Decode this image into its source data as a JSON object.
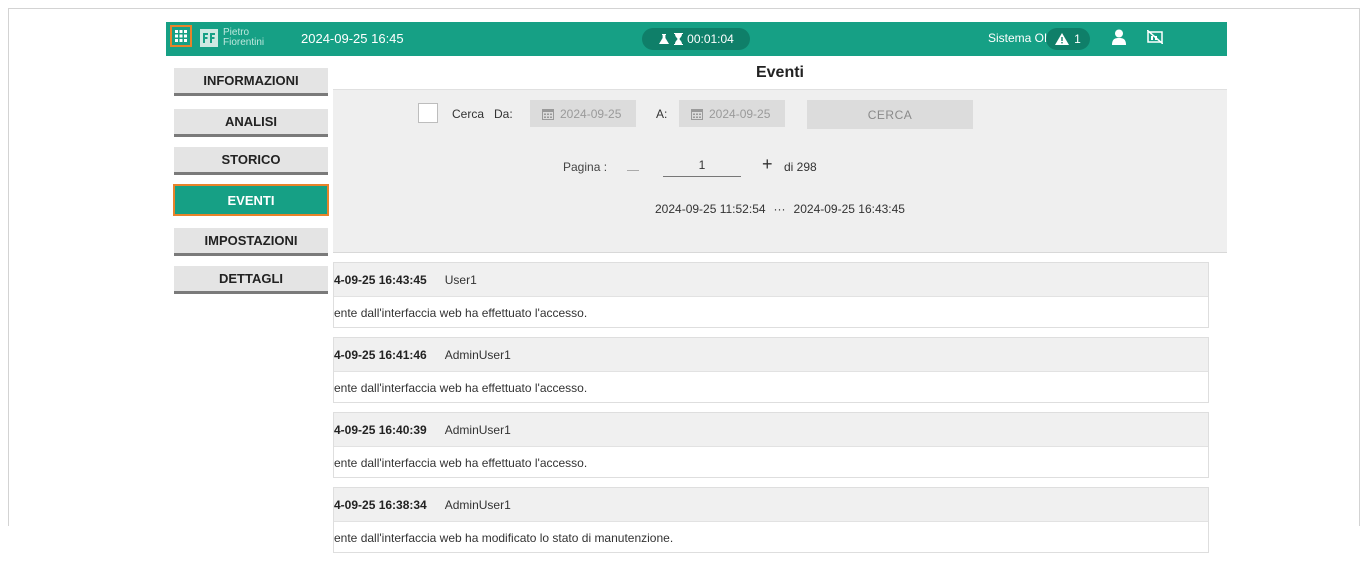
{
  "topbar": {
    "brand_line1": "Pietro",
    "brand_line2": "Fiorentini",
    "datetime": "2024-09-25 16:45",
    "timer": "00:01:04",
    "system_status": "Sistema OK",
    "alarm_count": "1",
    "accent_color": "#16a085"
  },
  "sidebar": {
    "items": [
      {
        "label": "INFORMAZIONI",
        "active": false
      },
      {
        "label": "ANALISI",
        "active": false
      },
      {
        "label": "STORICO",
        "active": false
      },
      {
        "label": "EVENTI",
        "active": true
      },
      {
        "label": "IMPOSTAZIONI",
        "active": false
      },
      {
        "label": "DETTAGLI",
        "active": false
      }
    ]
  },
  "main": {
    "title": "Eventi",
    "filter": {
      "search_label": "Cerca",
      "from_label": "Da:",
      "from_value": "2024-09-25",
      "to_label": "A:",
      "to_value": "2024-09-25",
      "search_button": "CERCA"
    },
    "pager": {
      "label": "Pagina :",
      "current_page": "1",
      "total_text": "di 298"
    },
    "range": {
      "start": "2024-09-25 11:52:54",
      "separator": "···",
      "end": "2024-09-25 16:43:45"
    },
    "events": [
      {
        "time": "4-09-25 16:43:45",
        "user": "User1",
        "message": "ente dall'interfaccia web ha effettuato l'accesso."
      },
      {
        "time": "4-09-25 16:41:46",
        "user": "AdminUser1",
        "message": "ente dall'interfaccia web ha effettuato l'accesso."
      },
      {
        "time": "4-09-25 16:40:39",
        "user": "AdminUser1",
        "message": "ente dall'interfaccia web ha effettuato l'accesso."
      },
      {
        "time": "4-09-25 16:38:34",
        "user": "AdminUser1",
        "message": "ente dall'interfaccia web ha modificato lo stato di manutenzione."
      }
    ]
  }
}
